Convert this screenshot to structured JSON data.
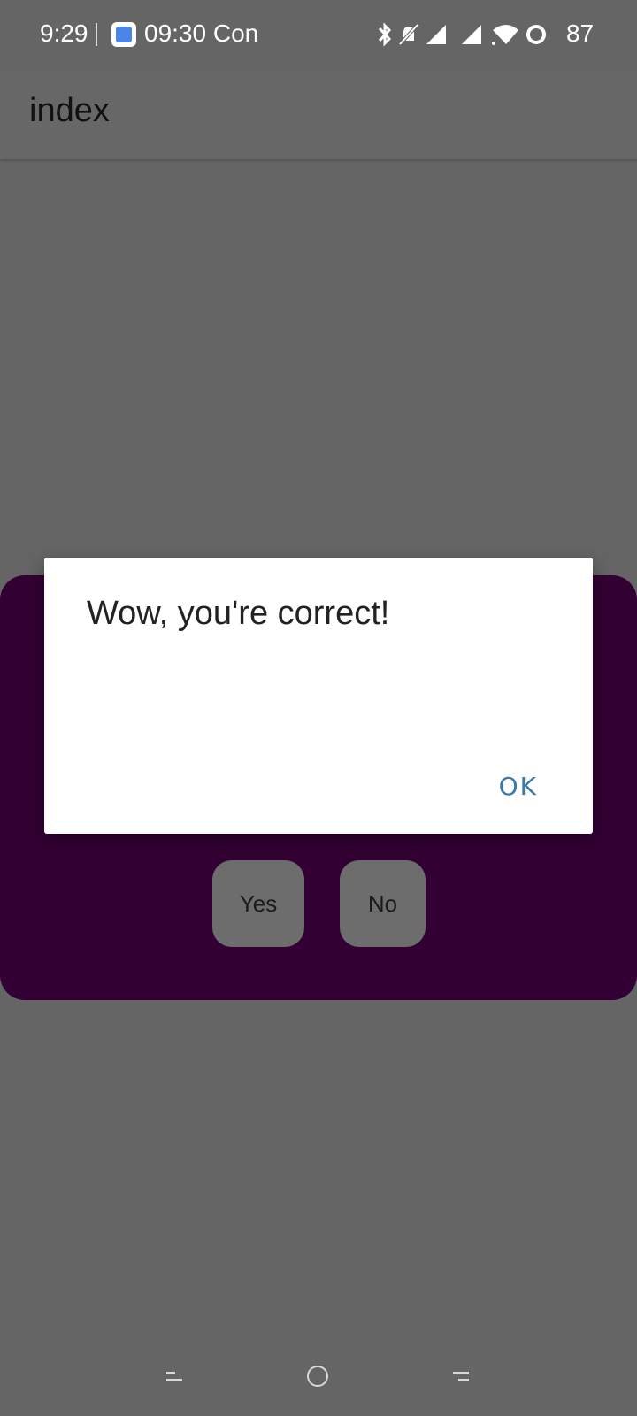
{
  "status_bar": {
    "time": "9:29",
    "notification_time": "09:30",
    "notification_text": "Con",
    "battery": "87",
    "icons": [
      "bluetooth-icon",
      "mute-icon",
      "signal-1-icon",
      "signal-2-icon",
      "wifi-icon",
      "battery-ring-icon"
    ]
  },
  "app_bar": {
    "title": "index"
  },
  "card": {
    "background": "#330033",
    "yes_label": "Yes",
    "no_label": "No"
  },
  "dialog": {
    "message": "Wow, you're correct!",
    "ok_label": "OK",
    "ok_color": "#3a78a8"
  },
  "nav_bar": {
    "buttons": [
      "back",
      "home",
      "recents"
    ]
  }
}
